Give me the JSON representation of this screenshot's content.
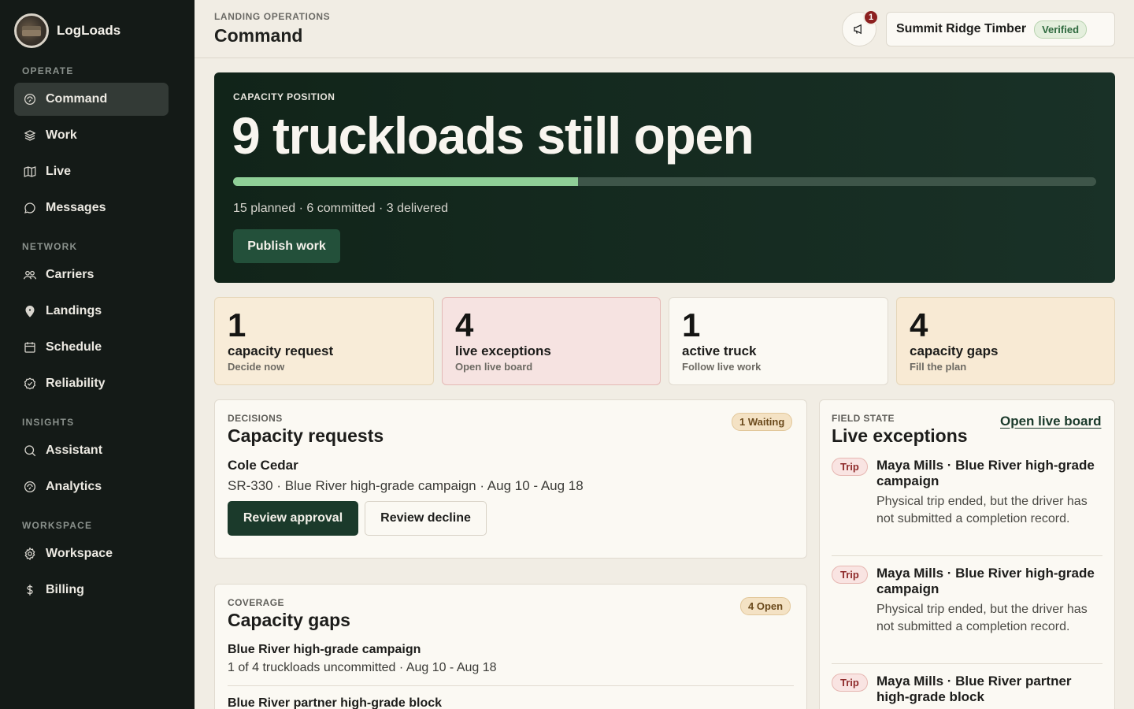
{
  "brand": {
    "name": "LogLoads"
  },
  "sidebar": {
    "groups": [
      {
        "label": "OPERATE",
        "items": [
          {
            "label": "Command",
            "icon": "command-icon",
            "active": true
          },
          {
            "label": "Work",
            "icon": "layers-icon"
          },
          {
            "label": "Live",
            "icon": "map-icon"
          },
          {
            "label": "Messages",
            "icon": "chat-icon"
          }
        ]
      },
      {
        "label": "NETWORK",
        "items": [
          {
            "label": "Carriers",
            "icon": "users-icon"
          },
          {
            "label": "Landings",
            "icon": "pin-icon"
          },
          {
            "label": "Schedule",
            "icon": "calendar-icon"
          },
          {
            "label": "Reliability",
            "icon": "badge-check-icon"
          }
        ]
      },
      {
        "label": "INSIGHTS",
        "items": [
          {
            "label": "Assistant",
            "icon": "search-icon"
          },
          {
            "label": "Analytics",
            "icon": "analytics-icon"
          }
        ]
      },
      {
        "label": "WORKSPACE",
        "items": [
          {
            "label": "Workspace",
            "icon": "gear-icon"
          },
          {
            "label": "Billing",
            "icon": "dollar-icon"
          }
        ]
      }
    ]
  },
  "header": {
    "breadcrumb": "LANDING OPERATIONS",
    "title": "Command",
    "notifications_count": "1",
    "org_name": "Summit Ridge Timber",
    "org_status": "Verified"
  },
  "hero": {
    "kicker": "CAPACITY POSITION",
    "title": "9 truckloads still open",
    "progress_fraction": 0.4,
    "summary": "15 planned · 6 committed · 3 delivered",
    "cta": "Publish work"
  },
  "stats": [
    {
      "value": "1",
      "label": "capacity request",
      "sub": "Decide now",
      "bg": "#f8ecd8"
    },
    {
      "value": "4",
      "label": "live exceptions",
      "sub": "Open live board",
      "bg": "#f6e3e1"
    },
    {
      "value": "1",
      "label": "active truck",
      "sub": "Follow live work",
      "bg": "#fbf9f3"
    },
    {
      "value": "4",
      "label": "capacity gaps",
      "sub": "Fill the plan",
      "bg": "#f8ead4"
    }
  ],
  "decisions": {
    "kicker": "DECISIONS",
    "title": "Capacity requests",
    "badge": "1 Waiting",
    "request": {
      "name": "Cole Cedar",
      "detail": "SR-330 · Blue River high-grade campaign · Aug 10 - Aug 18",
      "approve": "Review approval",
      "decline": "Review decline"
    }
  },
  "coverage": {
    "kicker": "COVERAGE",
    "title": "Capacity gaps",
    "badge": "4 Open",
    "gaps": [
      {
        "name": "Blue River high-grade campaign",
        "detail": "1 of 4 truckloads uncommitted · Aug 10 - Aug 18"
      },
      {
        "name": "Blue River partner high-grade block",
        "detail": ""
      }
    ]
  },
  "field": {
    "kicker": "FIELD STATE",
    "title": "Live exceptions",
    "link": "Open live board",
    "exceptions": [
      {
        "tag": "Trip",
        "title": "Maya Mills · Blue River high-grade campaign",
        "body": "Physical trip ended, but the driver has not submitted a completion record."
      },
      {
        "tag": "Trip",
        "title": "Maya Mills · Blue River high-grade campaign",
        "body": "Physical trip ended, but the driver has not submitted a completion record."
      },
      {
        "tag": "Trip",
        "title": "Maya Mills · Blue River partner high-grade block",
        "body": ""
      }
    ]
  }
}
